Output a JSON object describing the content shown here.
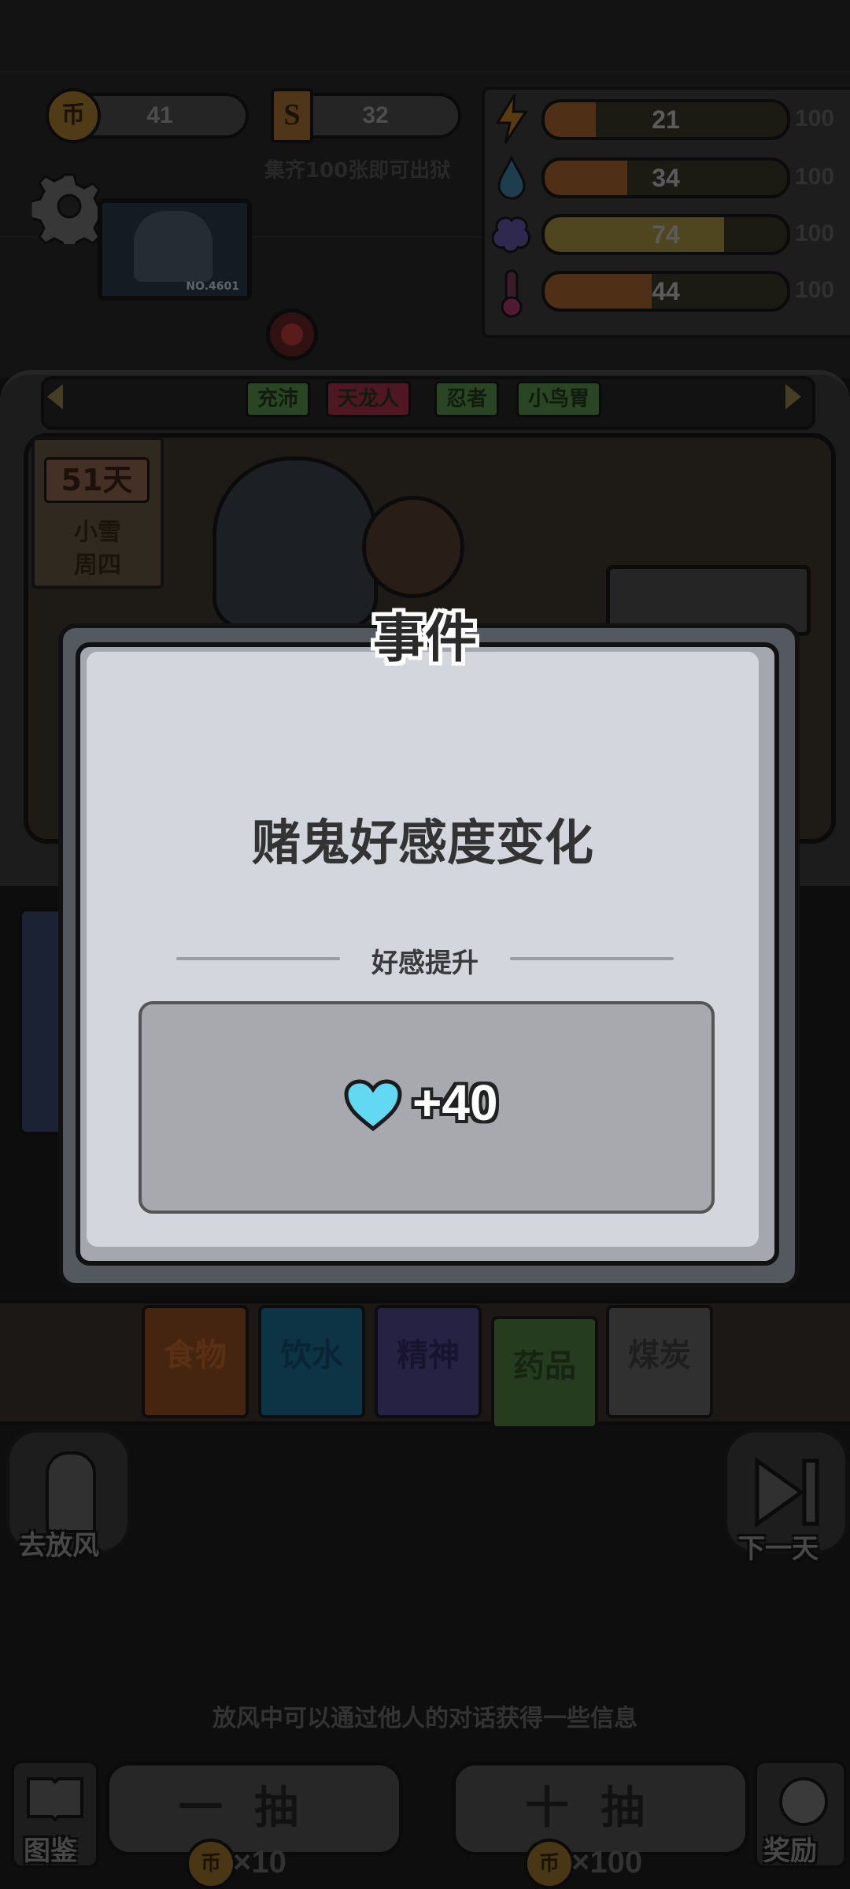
{
  "currency": {
    "coins": "41",
    "coin_icon_glyph": "币",
    "tickets": "32",
    "ticket_icon_glyph": "S",
    "collect_hint": "集齐100张即可出狱"
  },
  "stats": [
    {
      "name": "energy",
      "icon": "lightning-icon",
      "value": "21",
      "max": "100",
      "fraction": 0.21,
      "color": "#7a4a22"
    },
    {
      "name": "water",
      "icon": "water-drop-icon",
      "value": "34",
      "max": "100",
      "fraction": 0.34,
      "color": "#7a4a22"
    },
    {
      "name": "mind",
      "icon": "brain-icon",
      "value": "74",
      "max": "100",
      "fraction": 0.74,
      "color": "#7a6a30"
    },
    {
      "name": "health",
      "icon": "thermometer-icon",
      "value": "44",
      "max": "100",
      "fraction": 0.44,
      "color": "#7a4a22"
    }
  ],
  "room": {
    "tags": [
      {
        "label": "充沛",
        "color": "#3f6b36"
      },
      {
        "label": "天龙人",
        "color": "#7a2236"
      },
      {
        "label": "忍者",
        "color": "#3f6b36"
      },
      {
        "label": "小鸟胃",
        "color": "#3f6b36"
      }
    ],
    "day": "51天",
    "weather": "小雪",
    "weekday": "周四",
    "portrait_id": "NO.4601"
  },
  "modal": {
    "title": "事件",
    "event_text": "赌鬼好感度变化",
    "subtitle": "好感提升",
    "reward_value": "+40",
    "reward_icon": "heart-icon",
    "heart_color": "#63d8f3"
  },
  "resources": [
    {
      "label": "食物",
      "color": "#6b3a1a",
      "text_color": "#8a4a1f"
    },
    {
      "label": "饮水",
      "color": "#13506a",
      "text_color": "#0e3a4f"
    },
    {
      "label": "精神",
      "color": "#3b3568",
      "text_color": "#251f4a"
    },
    {
      "label": "药品",
      "color": "#3a5c30",
      "text_color": "#223a1c"
    },
    {
      "label": "煤炭",
      "color": "#4a4a4a",
      "text_color": "#2e2e2e"
    }
  ],
  "buttons": {
    "go_out": "去放风",
    "next_day": "下一天",
    "gallery": "图鉴",
    "reward": "奖励",
    "draw_one": "一抽",
    "draw_ten": "十抽",
    "draw_one_cost": "×10",
    "draw_ten_cost": "×100"
  },
  "hint_text": "放风中可以通过他人的对话获得一些信息"
}
